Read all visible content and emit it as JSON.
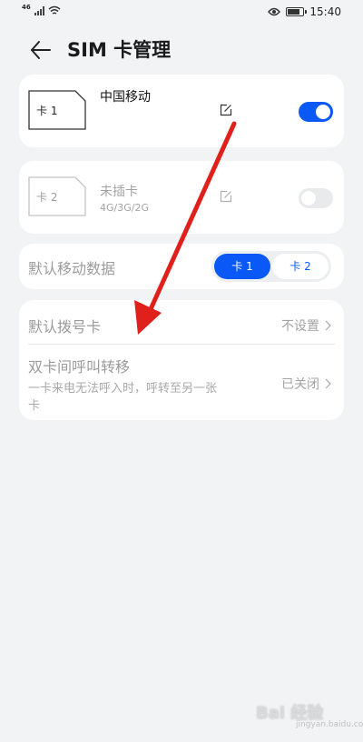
{
  "status_bar": {
    "signal_label": "46",
    "time": "15:40",
    "battery_level": 0.85
  },
  "header": {
    "title": "SIM 卡管理"
  },
  "sim_cards": [
    {
      "slot_label": "卡 1",
      "carrier": "中国移动",
      "enabled": true
    },
    {
      "slot_label": "卡 2",
      "status": "未插卡",
      "network": "4G/3G/2G",
      "enabled": false
    }
  ],
  "mobile_data": {
    "label": "默认移动数据",
    "options": [
      "卡 1",
      "卡 2"
    ],
    "selected": "卡 1"
  },
  "settings": {
    "default_dial": {
      "title": "默认拨号卡",
      "value": "不设置"
    },
    "call_forward": {
      "title": "双卡间呼叫转移",
      "subtitle": "一卡来电无法呼入时，呼转至另一张卡",
      "value": "已关闭"
    }
  },
  "colors": {
    "accent": "#0a59f7",
    "annotation_arrow": "#e0201b"
  },
  "watermark": {
    "text": "Bai 经验",
    "sub": "jingyan.baidu.com"
  }
}
